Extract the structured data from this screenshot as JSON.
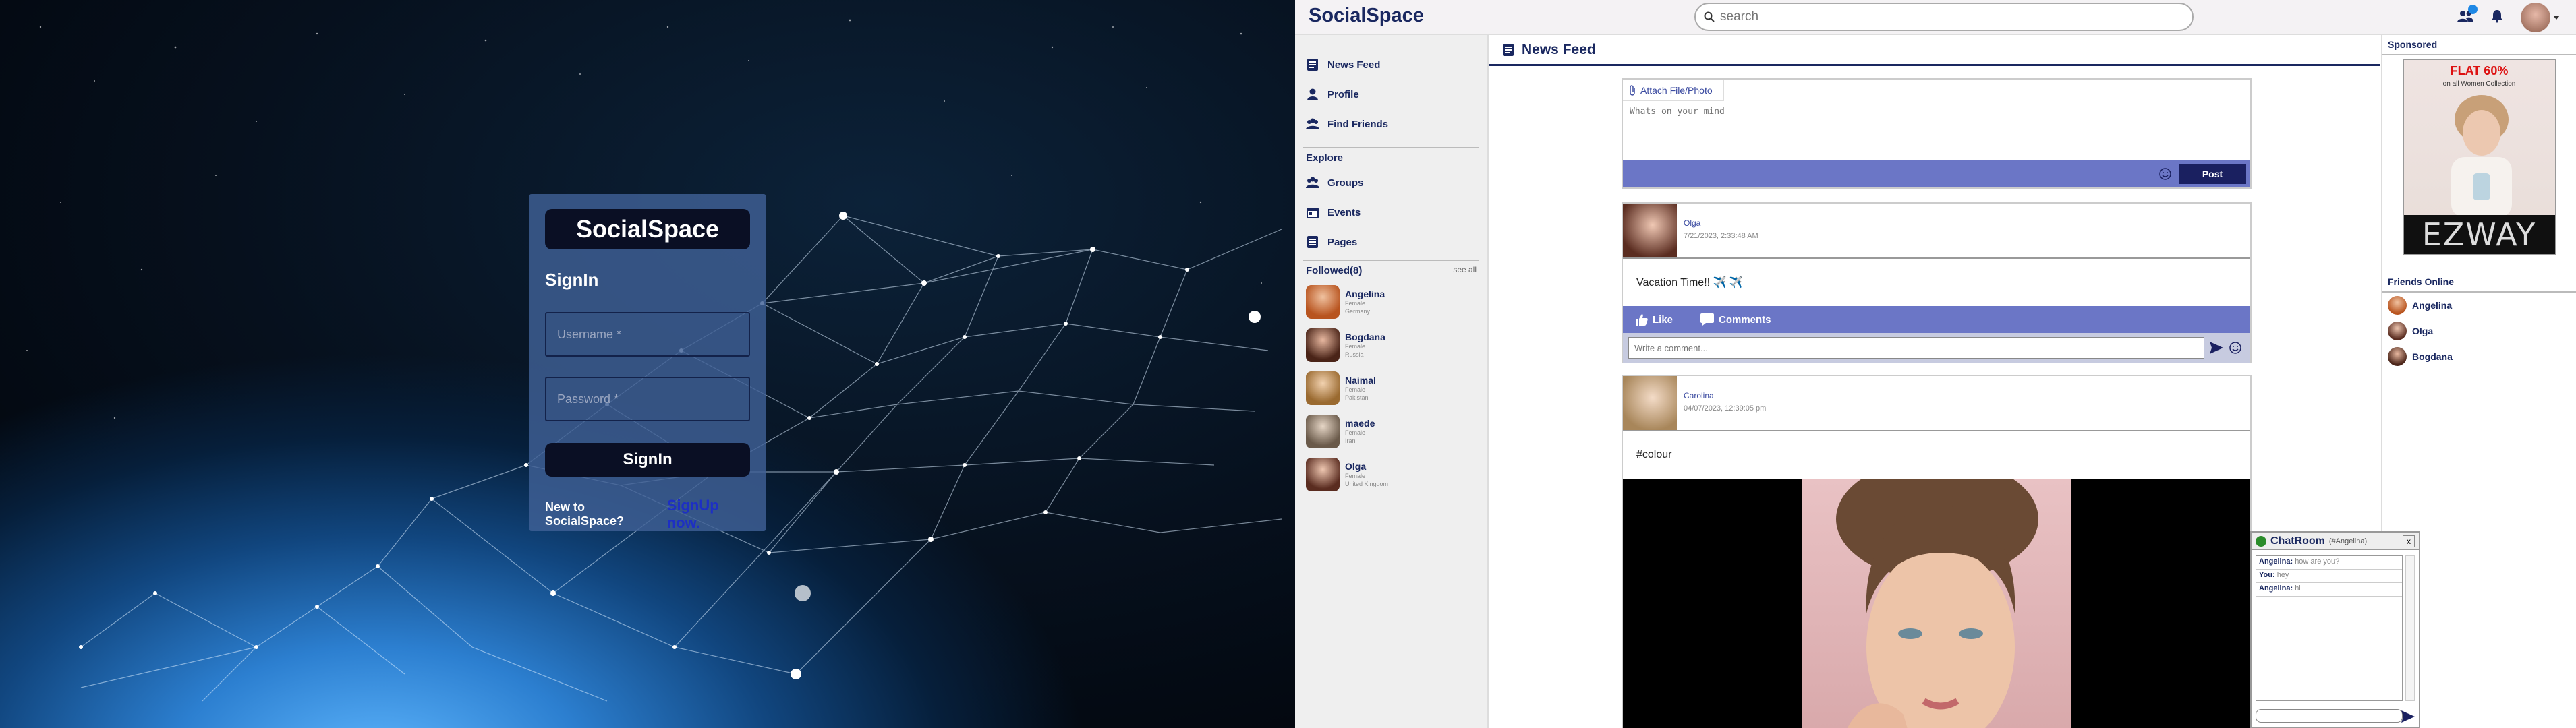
{
  "login": {
    "brand": "SocialSpace",
    "heading": "SignIn",
    "username_placeholder": "Username *",
    "password_placeholder": "Password *",
    "signin_label": "SignIn",
    "new_text": "New to SocialSpace?",
    "signup_link": "SignUp now."
  },
  "app": {
    "logo": "SocialSpace",
    "search_placeholder": "search",
    "sidebar": {
      "nav": [
        {
          "label": "News Feed"
        },
        {
          "label": "Profile"
        },
        {
          "label": "Find Friends"
        }
      ],
      "explore_title": "Explore",
      "explore": [
        {
          "label": "Groups"
        },
        {
          "label": "Events"
        },
        {
          "label": "Pages"
        }
      ],
      "followed_title": "Followed(8)",
      "see_all": "see all",
      "followed": [
        {
          "name": "Angelina",
          "l1": "Female",
          "l2": "Germany"
        },
        {
          "name": "Bogdana",
          "l1": "Female",
          "l2": "Russia"
        },
        {
          "name": "Naimal",
          "l1": "Female",
          "l2": "Pakistan"
        },
        {
          "name": "maede",
          "l1": "Female",
          "l2": "Iran"
        },
        {
          "name": "Olga",
          "l1": "Female",
          "l2": "United Kingdom"
        }
      ]
    },
    "main": {
      "title": "News Feed",
      "composer": {
        "attach_label": "Attach File/Photo",
        "placeholder": "Whats on your mind",
        "post_label": "Post"
      },
      "posts": [
        {
          "author": "Olga",
          "date": "7/21/2023, 2:33:48 AM",
          "text": "Vacation Time!!  ✈️ ✈️",
          "like": "Like",
          "comments": "Comments",
          "comment_placeholder": "Write a comment..."
        },
        {
          "author": "Carolina",
          "date": "04/07/2023, 12:39:05 pm",
          "text": "#colour"
        }
      ]
    },
    "rail": {
      "sponsored_title": "Sponsored",
      "ad": {
        "headline": "FLAT 60%",
        "sub": "on all Women Collection",
        "brand": "EZWAY"
      },
      "online_title": "Friends Online",
      "online": [
        {
          "name": "Angelina"
        },
        {
          "name": "Olga"
        },
        {
          "name": "Bogdana"
        }
      ]
    },
    "chat": {
      "title": "ChatRoom",
      "subtitle": "(#Angelina)",
      "close": "x",
      "messages": [
        {
          "from": "Angelina:",
          "text": "how are you?"
        },
        {
          "from": "You:",
          "text": "hey"
        },
        {
          "from": "Angelina:",
          "text": "hi"
        }
      ]
    }
  },
  "colors": {
    "brand": "#1a2860",
    "accent_bar": "#6b76c6",
    "dark_button": "#0a0f24",
    "link": "#1d2fc4"
  }
}
